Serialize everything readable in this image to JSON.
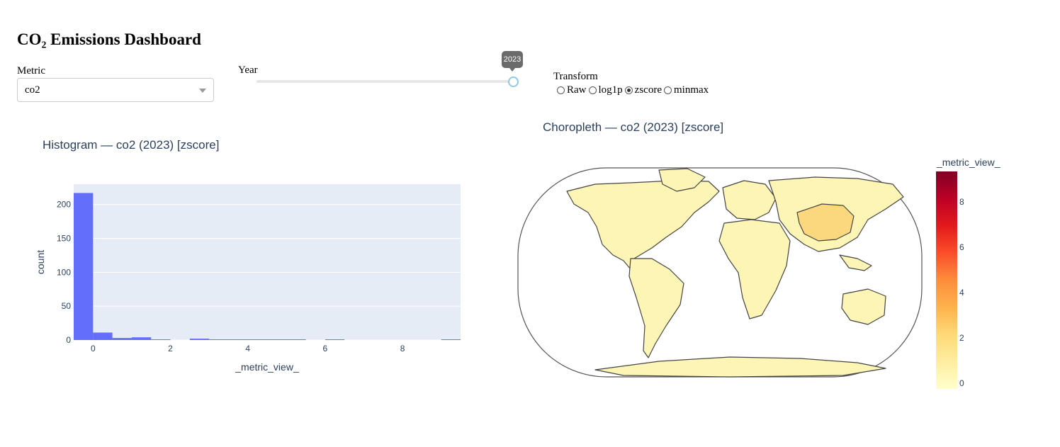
{
  "page": {
    "title": "CO₂ Emissions Dashboard"
  },
  "controls": {
    "metric": {
      "label": "Metric",
      "value": "co2"
    },
    "year": {
      "label": "Year",
      "value": "2023"
    },
    "transform": {
      "label": "Transform",
      "options": [
        "Raw",
        "log1p",
        "zscore",
        "minmax"
      ],
      "selected": "zscore"
    }
  },
  "colors": {
    "bar": "#636efa",
    "plot_bg": "#e5ecf6",
    "title_text": "#2a3f5f",
    "grid": "#ffffff"
  },
  "histogram": {
    "title": "Histogram — co2 (2023) [zscore]",
    "xlabel": "_metric_view_",
    "ylabel": "count"
  },
  "choropleth": {
    "title": "Choropleth — co2 (2023) [zscore]",
    "colorbar_title": "_metric_view_",
    "colorbar_ticks": [
      "0",
      "2",
      "4",
      "6",
      "8"
    ],
    "colorscale": [
      "#ffffcc",
      "#ffeda0",
      "#fed976",
      "#feb24c",
      "#fd8d3c",
      "#fc4e2a",
      "#e31a1c",
      "#bd0026",
      "#800026"
    ],
    "land_color": "#fdf5b6",
    "china_color": "#fbd77e"
  },
  "chart_data": {
    "type": "bar",
    "xlim": [
      -0.5,
      9.5
    ],
    "ylim": [
      0,
      230
    ],
    "x_ticks": [
      "0",
      "2",
      "4",
      "6",
      "8"
    ],
    "y_ticks": [
      "0",
      "50",
      "100",
      "150",
      "200"
    ],
    "bins": [
      {
        "x0": -0.5,
        "x1": 0.0,
        "count": 217
      },
      {
        "x0": 0.0,
        "x1": 0.5,
        "count": 11
      },
      {
        "x0": 0.5,
        "x1": 1.0,
        "count": 3
      },
      {
        "x0": 1.0,
        "x1": 1.5,
        "count": 4
      },
      {
        "x0": 1.5,
        "x1": 2.0,
        "count": 1
      },
      {
        "x0": 2.5,
        "x1": 3.0,
        "count": 2
      },
      {
        "x0": 3.0,
        "x1": 3.5,
        "count": 1
      },
      {
        "x0": 3.5,
        "x1": 4.0,
        "count": 1
      },
      {
        "x0": 4.0,
        "x1": 4.5,
        "count": 1
      },
      {
        "x0": 4.5,
        "x1": 5.0,
        "count": 1
      },
      {
        "x0": 5.0,
        "x1": 5.5,
        "count": 1
      },
      {
        "x0": 6.0,
        "x1": 6.5,
        "count": 1
      },
      {
        "x0": 9.0,
        "x1": 9.5,
        "count": 1
      }
    ]
  }
}
